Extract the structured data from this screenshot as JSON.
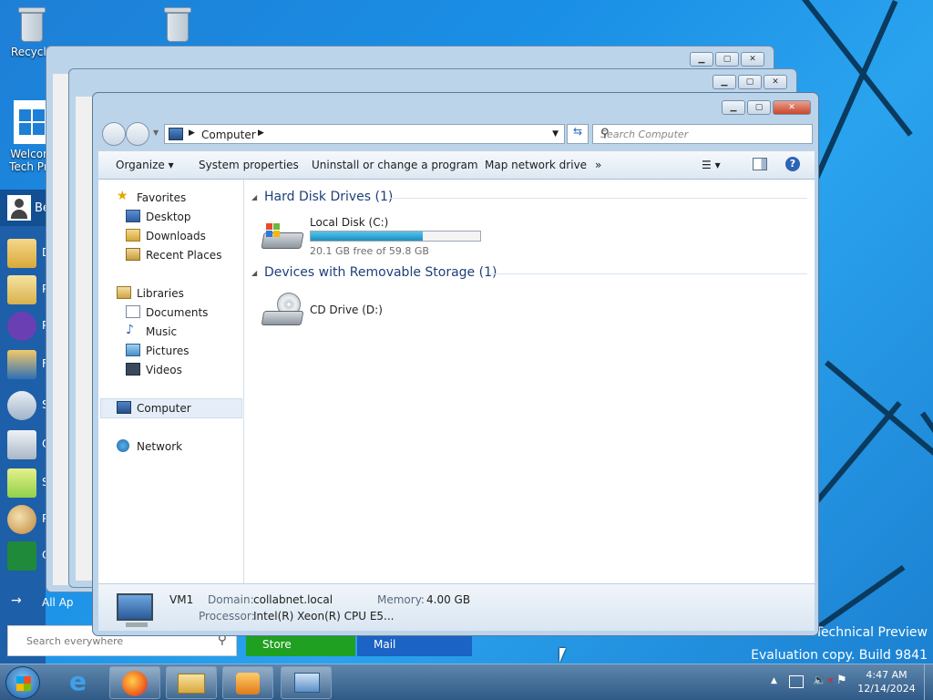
{
  "desktop": {
    "icons": [
      {
        "label": "Recycle"
      },
      {
        "label": ""
      },
      {
        "label": "Welcom\nTech Pre"
      }
    ],
    "watermark": {
      "line1": "Technical Preview",
      "line2": "Evaluation copy. Build 9841"
    }
  },
  "start_menu": {
    "user_label": "Be",
    "item_letters": [
      "D",
      "P",
      "P",
      "F",
      "S",
      "C",
      "S",
      "P",
      "C"
    ],
    "all_apps": "All Ap",
    "search_placeholder": "Search everywhere",
    "tiles": {
      "store": "Store",
      "mail": "Mail"
    }
  },
  "explorer": {
    "breadcrumb": "Computer",
    "search_placeholder": "Search Computer",
    "toolbar": {
      "organize": "Organize",
      "system_properties": "System properties",
      "uninstall": "Uninstall or change a program",
      "map_drive": "Map network drive",
      "more": "»"
    },
    "nav": {
      "favorites": "Favorites",
      "desktop": "Desktop",
      "downloads": "Downloads",
      "recent_places": "Recent Places",
      "libraries": "Libraries",
      "documents": "Documents",
      "music": "Music",
      "pictures": "Pictures",
      "videos": "Videos",
      "computer": "Computer",
      "network": "Network"
    },
    "groups": {
      "hdd": "Hard Disk Drives (1)",
      "removable": "Devices with Removable Storage (1)"
    },
    "drives": {
      "c_name": "Local Disk (C:)",
      "c_free": "20.1 GB free of 59.8 GB",
      "c_used_fraction": 0.66,
      "d_name": "CD Drive (D:)"
    },
    "details": {
      "name": "VM1",
      "domain_label": "Domain:",
      "domain_value": "collabnet.local",
      "memory_label": "Memory:",
      "memory_value": "4.00 GB",
      "processor_label": "Processor:",
      "processor_value": "Intel(R) Xeon(R) CPU E5..."
    }
  },
  "taskbar": {
    "time": "4:47 AM",
    "date": "12/14/2024"
  },
  "colors": {
    "accent": "#1e3f78",
    "start_blue": "#1d5fa8",
    "store_green": "#20a020",
    "mail_blue": "#1b63c4"
  }
}
